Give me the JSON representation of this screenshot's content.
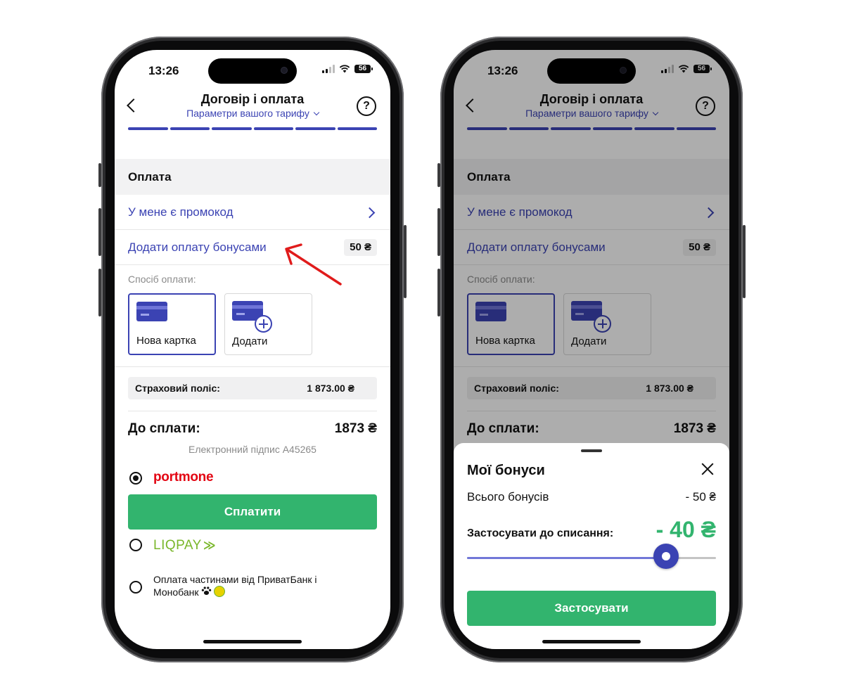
{
  "status_bar": {
    "time": "13:26",
    "battery": "56"
  },
  "header": {
    "title": "Договір і оплата",
    "subtitle": "Параметри вашого тарифу"
  },
  "payment": {
    "section_title": "Оплата",
    "promo_label": "У мене є промокод",
    "bonus_label": "Додати оплату бонусами",
    "bonus_badge": "50 ₴",
    "method_label": "Спосіб оплати:",
    "methods": [
      {
        "label": "Нова картка"
      },
      {
        "label": "Додати"
      }
    ]
  },
  "summary": {
    "policy_label": "Страховий поліс:",
    "policy_value": "1 873.00 ₴",
    "total_label": "До сплати:",
    "total_value": "1873 ₴",
    "esign": "Електронний підпис А45265"
  },
  "providers": {
    "portmone": "portmone",
    "pay_button": "Сплатити",
    "liqpay": "LIQPAY",
    "installments": "Оплата частинами від ПриватБанк і Монобанк"
  },
  "sheet": {
    "title": "Мої бонуси",
    "total_label": "Всього бонусів",
    "total_value": "- 50 ₴",
    "apply_label": "Застосувати до списання:",
    "apply_amount": "- 40 ₴",
    "slider_fraction": 0.8,
    "apply_button": "Застосувати"
  },
  "colors": {
    "accent": "#3b43b3",
    "green": "#32b46e",
    "portmone_red": "#e30613",
    "liqpay_green": "#7ab72b"
  }
}
